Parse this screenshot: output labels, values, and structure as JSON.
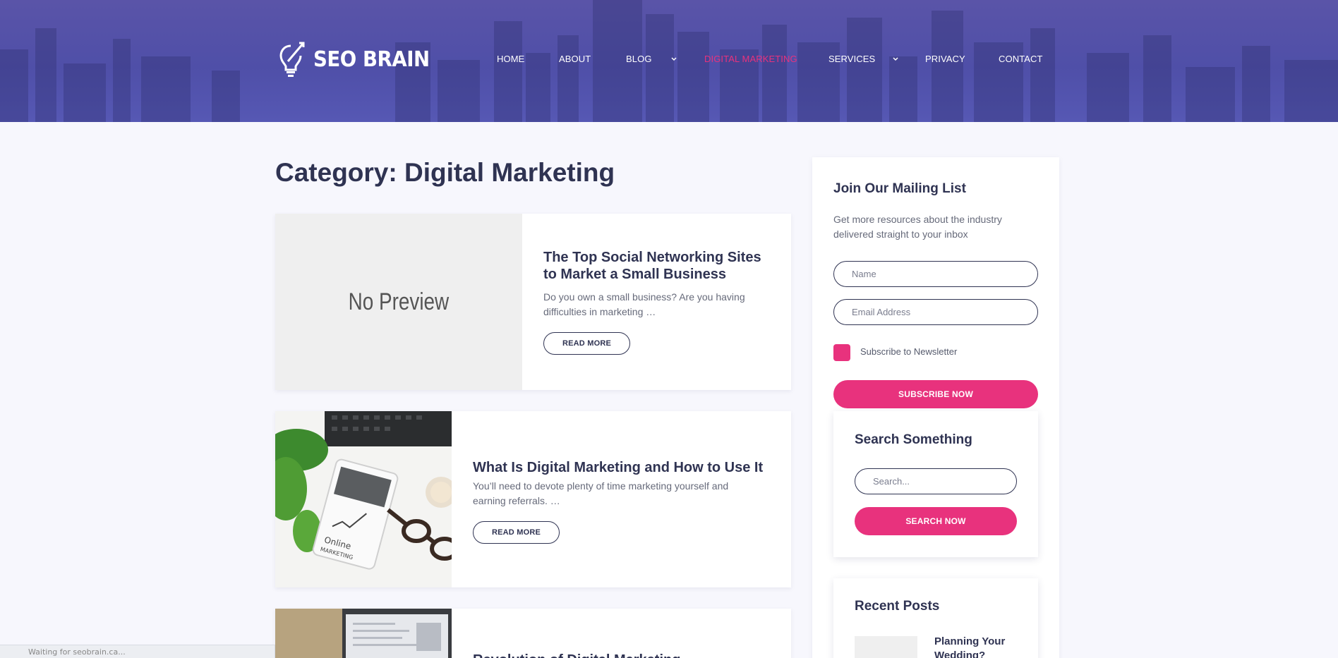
{
  "site": {
    "logo_text": "SEO BRAIN",
    "accent_color": "#e8327d",
    "header_color": "#5452a8"
  },
  "nav": {
    "items": [
      {
        "label": "HOME",
        "active": false,
        "has_dropdown": false
      },
      {
        "label": "ABOUT",
        "active": false,
        "has_dropdown": false
      },
      {
        "label": "BLOG",
        "active": false,
        "has_dropdown": true
      },
      {
        "label": "DIGITAL MARKETING",
        "active": true,
        "has_dropdown": false
      },
      {
        "label": "SERVICES",
        "active": false,
        "has_dropdown": true
      },
      {
        "label": "PRIVACY",
        "active": false,
        "has_dropdown": false
      },
      {
        "label": "CONTACT",
        "active": false,
        "has_dropdown": false
      }
    ]
  },
  "main": {
    "page_title": "Category: Digital Marketing",
    "posts": [
      {
        "thumbnail": "No Preview",
        "title": "The Top Social Networking Sites to Market a Small Business",
        "excerpt": "Do you own a small business? Are you having difficulties in marketing …",
        "button": "READ MORE"
      },
      {
        "thumbnail_icon": "tablet-online-marketing-image",
        "title": "What Is Digital Marketing and How to Use It",
        "excerpt": "You’ll need to devote plenty of time marketing yourself and earning referrals. …",
        "button": "READ MORE"
      },
      {
        "thumbnail_icon": "laptop-desk-image",
        "title": "Revolution of Digital Marketing"
      }
    ]
  },
  "sidebar": {
    "mailing": {
      "title": "Join Our Mailing List",
      "description": "Get more resources about the industry delivered straight to your inbox",
      "name_placeholder": "Name",
      "email_placeholder": "Email Address",
      "checkbox_label": "Subscribe to Newsletter",
      "button": "SUBSCRIBE NOW"
    },
    "search": {
      "title": "Search Something",
      "placeholder": "Search...",
      "button": "SEARCH NOW"
    },
    "recent": {
      "title": "Recent Posts",
      "items": [
        {
          "title": "Planning Your Wedding?"
        }
      ]
    }
  },
  "status_bar": "Waiting for seobrain.ca..."
}
